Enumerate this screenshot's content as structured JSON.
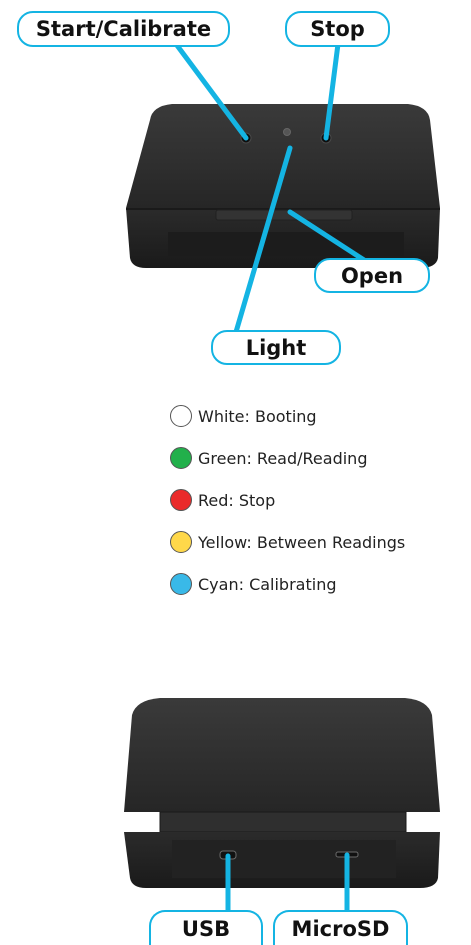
{
  "callouts": {
    "start_calibrate": "Start/Calibrate",
    "stop": "Stop",
    "open": "Open",
    "light": "Light",
    "usb": "USB",
    "microsd": "MicroSD"
  },
  "legend": [
    {
      "label": "White: Booting",
      "color": "#ffffff",
      "border": "#555555"
    },
    {
      "label": "Green: Read/Reading",
      "color": "#22b04b",
      "border": "#555555"
    },
    {
      "label": "Red: Stop",
      "color": "#ea2b2b",
      "border": "#555555"
    },
    {
      "label": "Yellow: Between Readings",
      "color": "#ffd84a",
      "border": "#555555"
    },
    {
      "label": "Cyan: Calibrating",
      "color": "#39b9e8",
      "border": "#555555"
    }
  ],
  "colors": {
    "accent": "#14b4e3",
    "device_body": "#2a2a2a"
  }
}
